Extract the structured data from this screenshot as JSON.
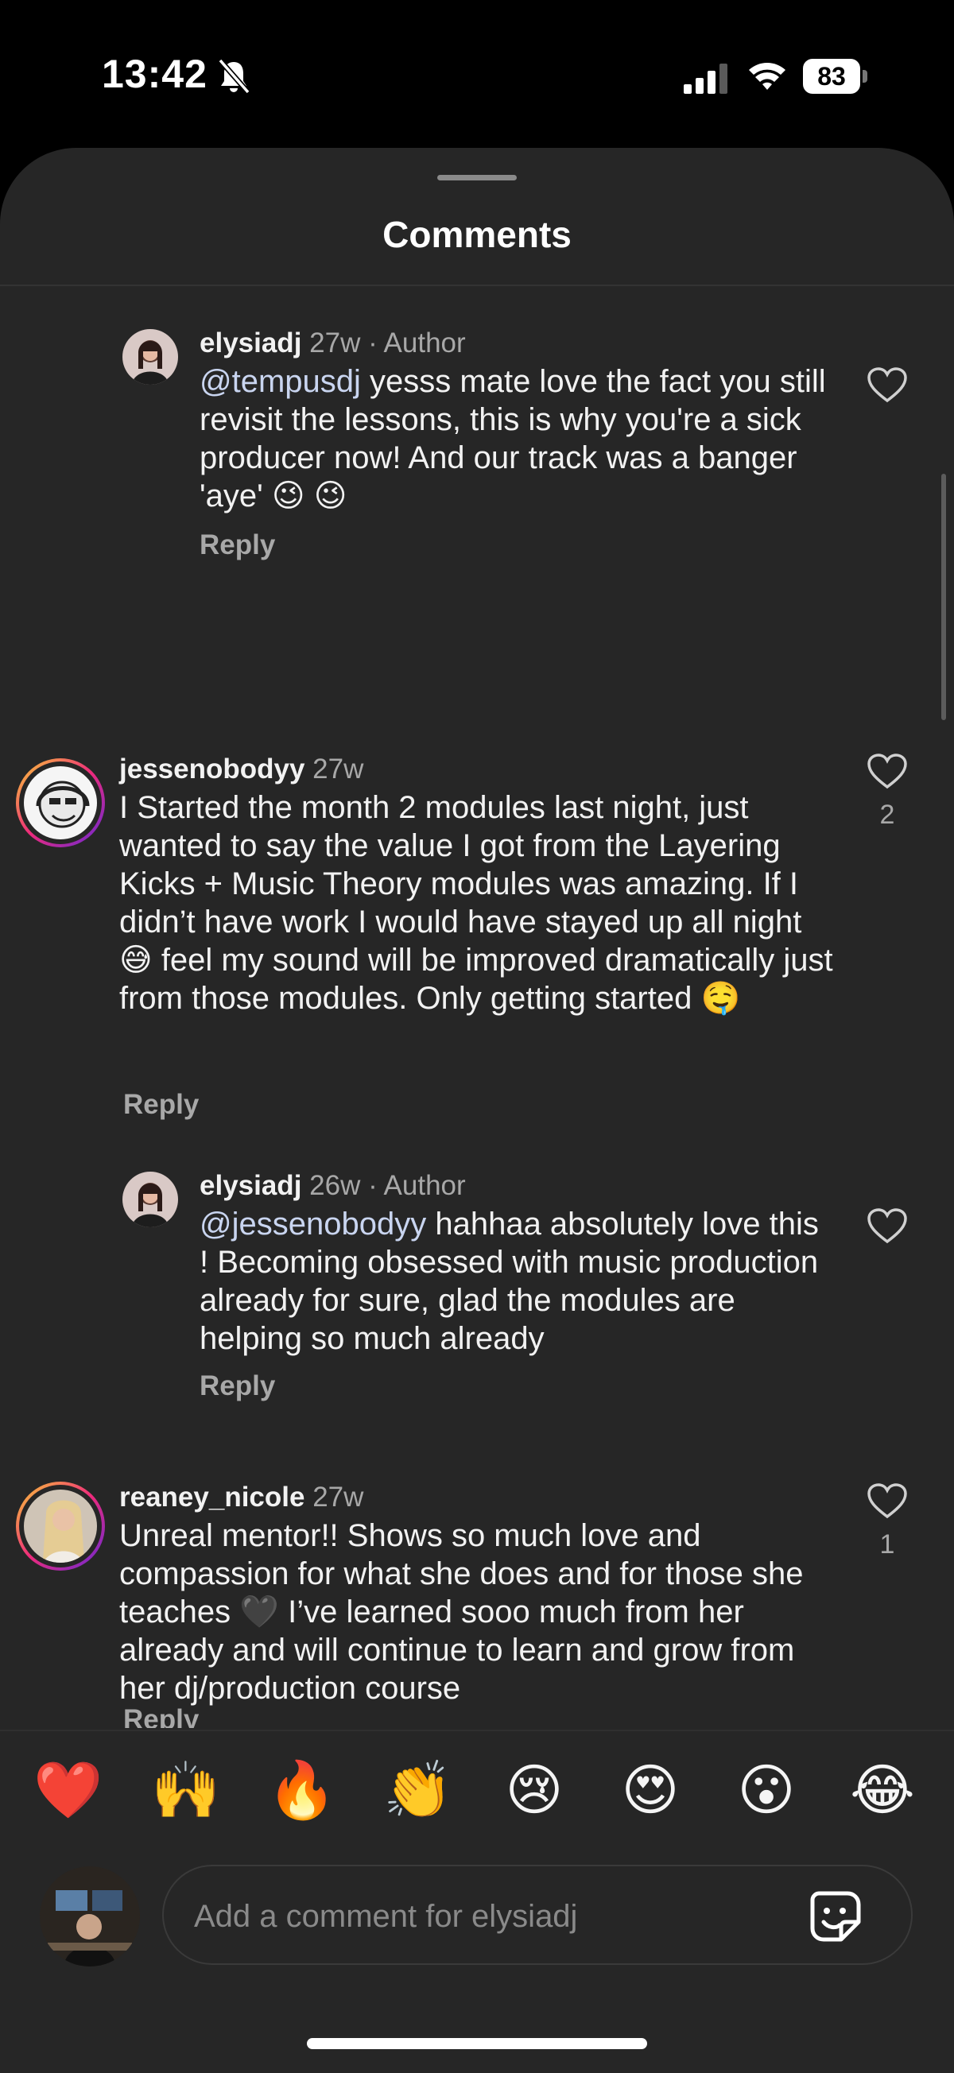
{
  "status_bar": {
    "time": "13:42",
    "battery": "83"
  },
  "sheet": {
    "title": "Comments"
  },
  "comments": [
    {
      "username": "elysiadj",
      "time": "27w",
      "tag": "· Author",
      "mention": "@tempusdj",
      "text": " yesss mate love the fact you still revisit the lessons, this is why you're a sick producer now! And our track was a banger 'aye' ",
      "emojis": [
        "😉",
        "😉"
      ],
      "reply": "Reply",
      "likes": ""
    },
    {
      "username": "jessenobodyy",
      "time": "27w",
      "tag": "",
      "text_a": "I Started the month 2 modules last night, just wanted to say the value I got from the Layering Kicks + Music Theory modules was amazing. If I didn’t have work I would have stayed up all night ",
      "emoji_a": "😅",
      "text_b": " feel my sound will be improved dramatically just from those modules. Only getting started ",
      "emoji_b": "🤤",
      "reply": "Reply",
      "likes": "2"
    },
    {
      "username": "elysiadj",
      "time": "26w",
      "tag": "· Author",
      "mention": "@jessenobodyy",
      "text": " hahhaa absolutely love this ! Becoming obsessed with music production already for sure, glad the modules are helping so much already",
      "reply": "Reply",
      "likes": ""
    },
    {
      "username": "reaney_nicole",
      "time": "27w",
      "tag": "",
      "text_a": "Unreal mentor!! Shows so much love and compassion for what she does and for those she teaches ",
      "emoji_a": "🖤",
      "text_b": " I’ve learned sooo much from her already and will continue to learn and grow from her dj/production course",
      "reply": "Reply",
      "likes": "1"
    }
  ],
  "reactions": [
    "❤️",
    "🙌",
    "🔥",
    "👏",
    "😢",
    "😍",
    "😮",
    "😂"
  ],
  "composer": {
    "placeholder": "Add a comment for elysiadj"
  },
  "colors": {
    "background": "#262626",
    "text": "#f5f5f5",
    "muted": "#a8a8a8",
    "mention": "#c9d5f0"
  },
  "icons": [
    "bell-slash-icon",
    "signal-icon",
    "wifi-icon",
    "heart-icon",
    "sticker-icon"
  ]
}
